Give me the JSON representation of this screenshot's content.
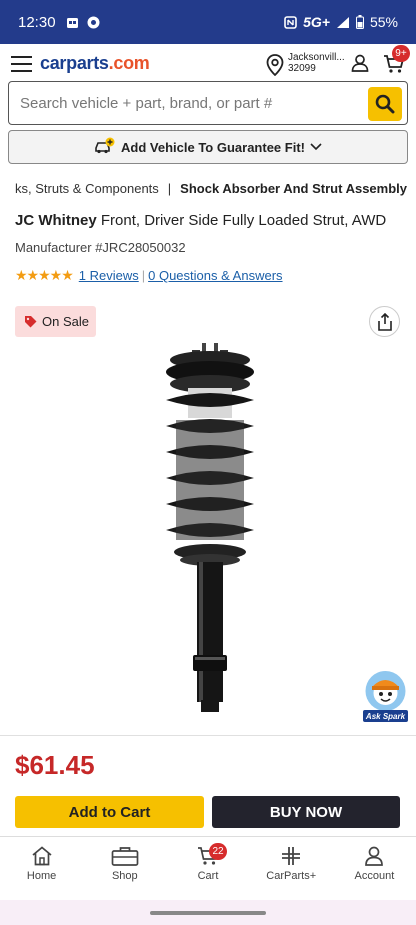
{
  "status_bar": {
    "time": "12:30",
    "network": "5G+",
    "battery": "55%"
  },
  "header": {
    "logo_main": "carparts",
    "logo_suffix": ".com",
    "location_line1": "Jacksonvill...",
    "location_line2": "32099",
    "cart_count": "9+"
  },
  "search": {
    "placeholder": "Search vehicle + part, brand, or part #"
  },
  "add_vehicle": {
    "label": "Add Vehicle To Guarantee Fit!"
  },
  "breadcrumb": {
    "parent": "ks, Struts & Components",
    "separator": "|",
    "current": "Shock Absorber And Strut Assembly"
  },
  "product": {
    "brand": "JC Whitney",
    "title_rest": " Front, Driver Side Fully Loaded Strut, AWD",
    "manufacturer_number": "Manufacturer #JRC28050032",
    "stars": "★★★★★",
    "rating_value": 5,
    "reviews_link": "1 Reviews",
    "qa_link": "0 Questions & Answers",
    "sale_badge": "On Sale",
    "price": "$61.45"
  },
  "assistant": {
    "label": "Ask Spark"
  },
  "actions": {
    "add_to_cart": "Add to Cart",
    "buy_now": "BUY NOW"
  },
  "bottom_nav": {
    "items": [
      {
        "label": "Home",
        "icon": "home-icon"
      },
      {
        "label": "Shop",
        "icon": "toolbox-icon"
      },
      {
        "label": "Cart",
        "icon": "cart-icon",
        "badge": "22"
      },
      {
        "label": "CarParts+",
        "icon": "carparts-plus-icon"
      },
      {
        "label": "Account",
        "icon": "user-icon"
      }
    ]
  },
  "colors": {
    "brand_blue": "#1a3f8f",
    "accent_yellow": "#f6c000",
    "price_red": "#c62828",
    "status_bar": "#233b8b"
  }
}
